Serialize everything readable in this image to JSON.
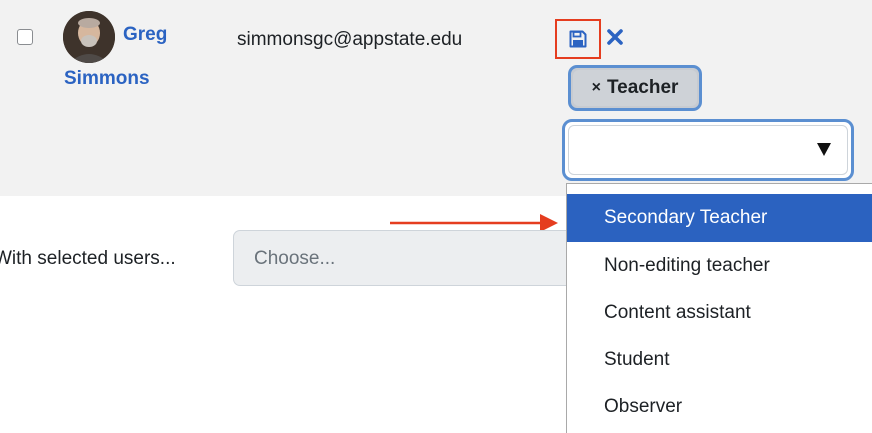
{
  "user": {
    "first_name": "Greg",
    "last_name": "Simmons",
    "email": "simmonsgc@appstate.edu"
  },
  "role_chip": {
    "remove_glyph": "×",
    "label": "Teacher"
  },
  "role_dropdown": {
    "options": [
      {
        "label": "Secondary Teacher",
        "selected": true
      },
      {
        "label": "Non-editing teacher",
        "selected": false
      },
      {
        "label": "Content assistant",
        "selected": false
      },
      {
        "label": "Student",
        "selected": false
      },
      {
        "label": "Observer",
        "selected": false
      }
    ]
  },
  "bulk_actions": {
    "label": "With selected users...",
    "placeholder": "Choose..."
  },
  "icons": {
    "save": "save-floppy-icon",
    "cancel": "close-x-icon",
    "caret": "caret-down-icon"
  },
  "colors": {
    "link": "#2b63c2",
    "highlight": "#e53d1f",
    "selected_option": "#2b62c0",
    "focus_border": "#5b8fd1"
  }
}
